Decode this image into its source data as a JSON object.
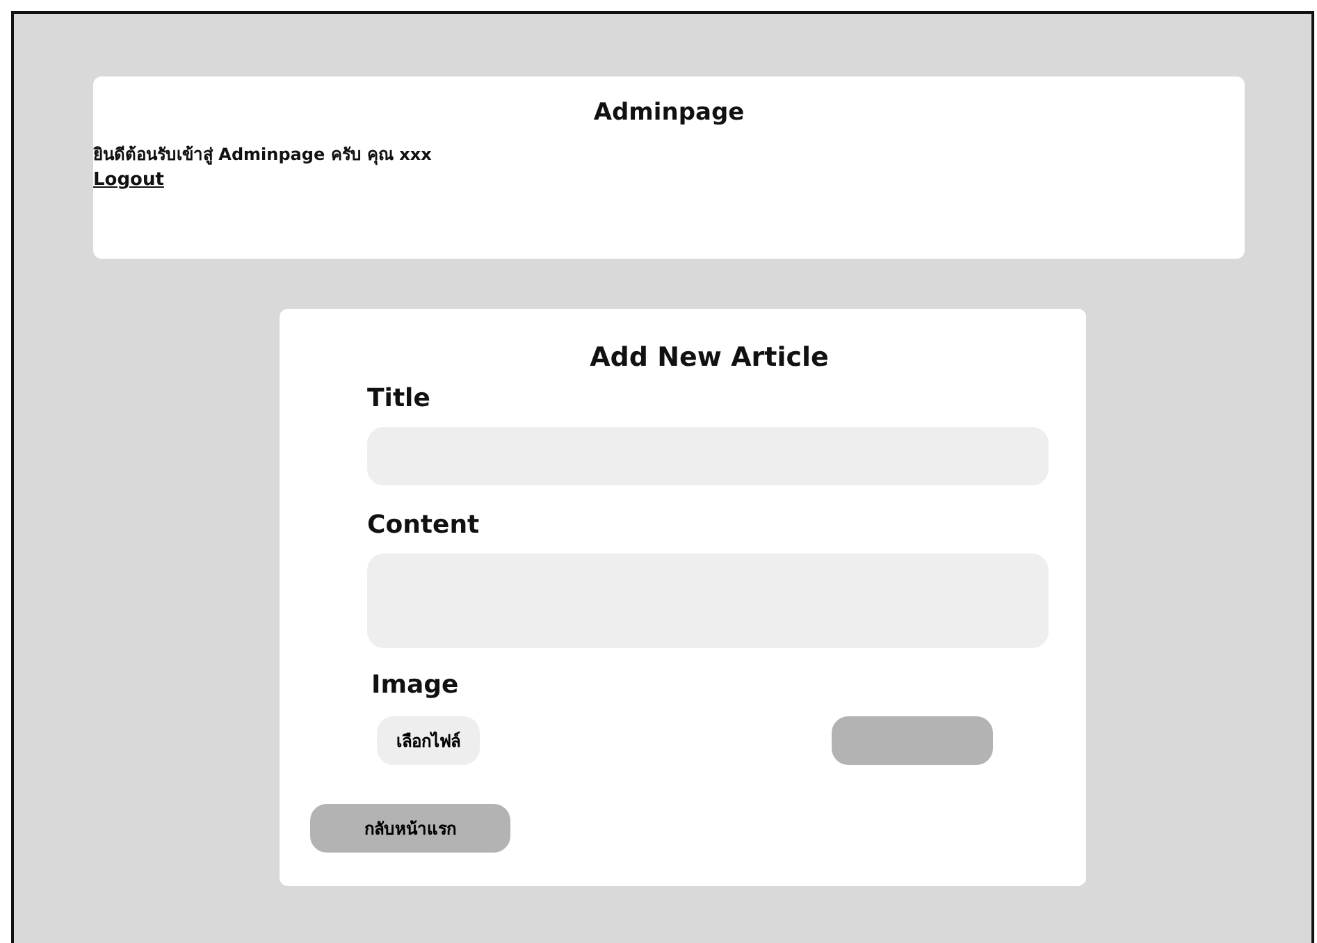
{
  "header": {
    "title": "Adminpage",
    "welcome": "ยินดีต้อนรับเข้าสู่ Adminpage ครับ คุณ xxx",
    "logout": "Logout"
  },
  "form": {
    "heading": "Add New Article",
    "fields": [
      {
        "label": "Title",
        "kind": "input"
      },
      {
        "label": "Content",
        "kind": "textarea"
      }
    ],
    "image_label": "Image",
    "file_button": "เลือกไฟล์",
    "back_button": "กลับหน้าแรก"
  }
}
